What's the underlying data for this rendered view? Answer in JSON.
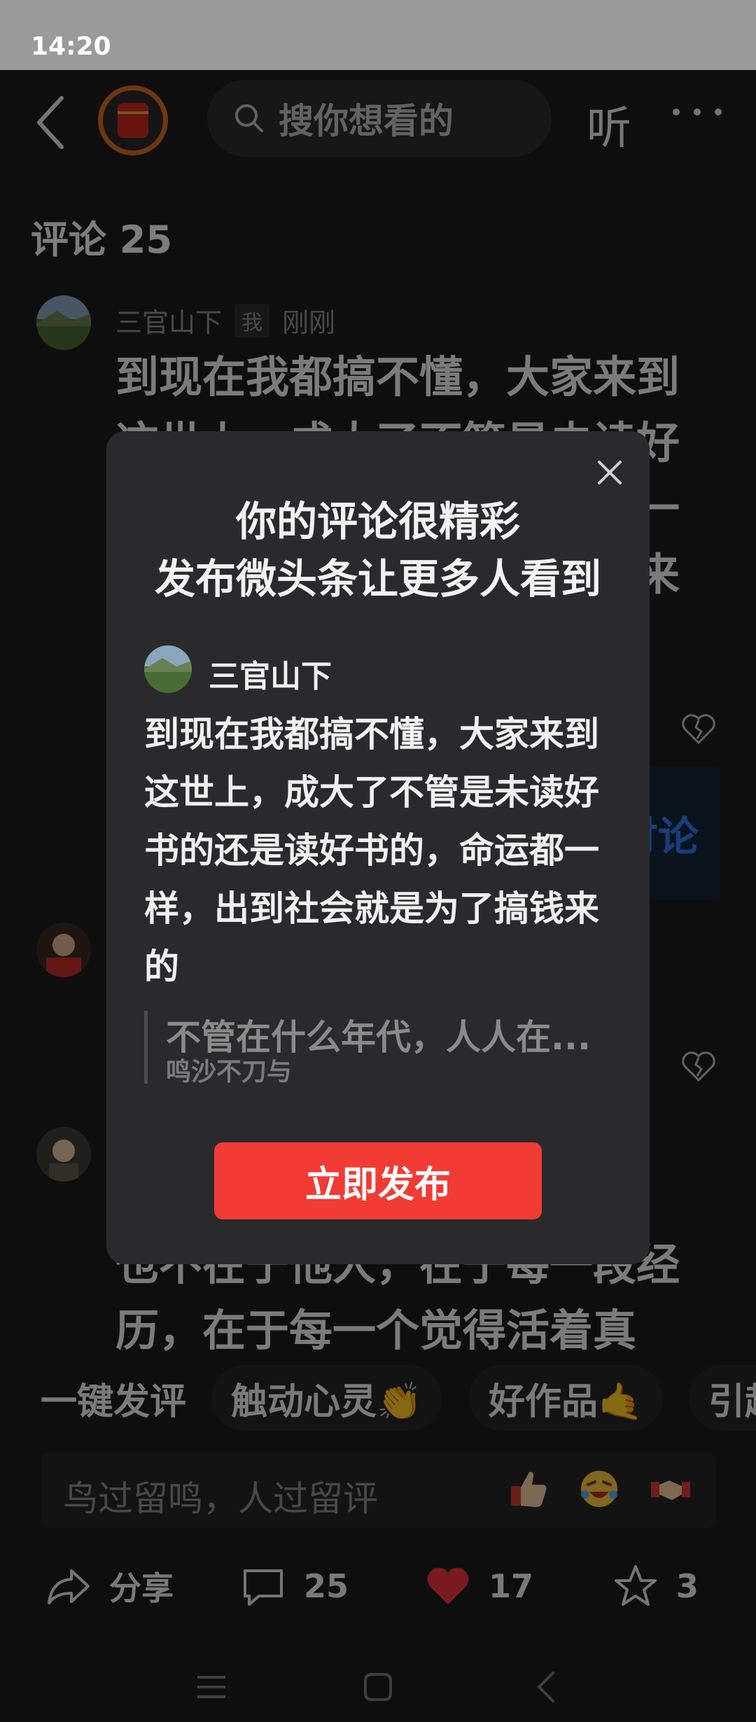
{
  "status": {
    "time": "14:20"
  },
  "topbar": {
    "search_placeholder": "搜你想看的",
    "listen_label": "听"
  },
  "comments": {
    "title": "评论 25",
    "items": [
      {
        "user": "三官山下",
        "badge": "我",
        "time": "刚刚",
        "text": "到现在我都搞不懂，大家来到这世上，成大了不管是未读好书的还是读好书的，命运都一样，出到社会就是为了搞钱来的"
      },
      {
        "user": "",
        "text": ""
      },
      {
        "user": "",
        "text": "也不在于他人，在于每一段经历，在于每一个觉得活着真"
      }
    ],
    "discuss_label": "讨论"
  },
  "chips": [
    "一键发评",
    "触动心灵👏",
    "好作品🤙",
    "引起"
  ],
  "input": {
    "placeholder": "鸟过留鸣，人过留评",
    "emojis": [
      "thumbs-up-emoji",
      "laughing-emoji",
      "handshake-emoji"
    ]
  },
  "actions": {
    "share_label": "分享",
    "comment_count": "25",
    "like_count": "17",
    "favorite_count": "3"
  },
  "modal": {
    "title_line1": "你的评论很精彩",
    "title_line2": "发布微头条让更多人看到",
    "user": "三官山下",
    "body": "到现在我都搞不懂，大家来到这世上，成大了不管是未读好书的还是读好书的，命运都一样，出到社会就是为了搞钱来的",
    "quote_line1": "不管在什么年代，人人在...",
    "quote_line2": "鸣沙不刀与",
    "publish_label": "立即发布"
  },
  "colors": {
    "accent_red": "#f23b35",
    "like_red": "#e8333a",
    "link_blue": "#2d78e8"
  }
}
